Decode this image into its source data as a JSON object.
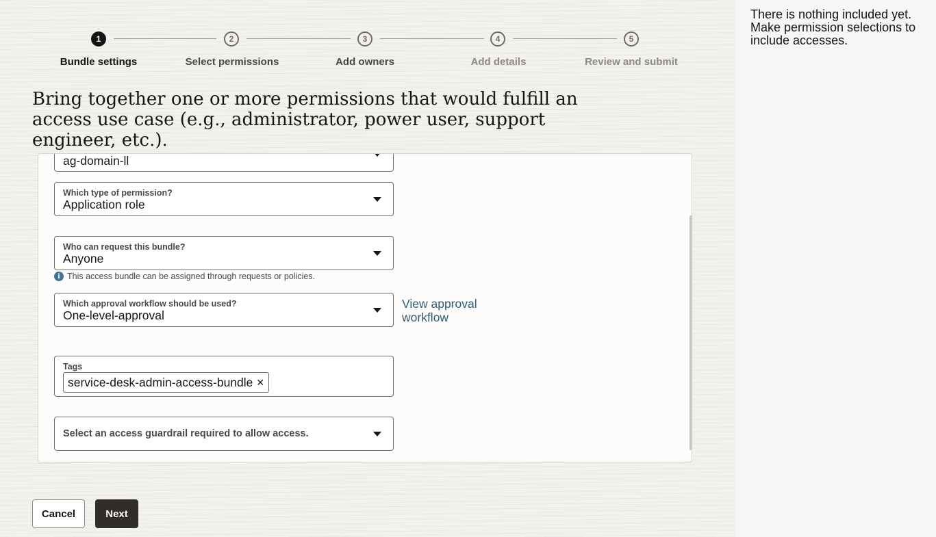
{
  "stepper": {
    "steps": [
      {
        "number": "1",
        "label": "Bundle settings",
        "state": "active"
      },
      {
        "number": "2",
        "label": "Select permissions",
        "state": "next"
      },
      {
        "number": "3",
        "label": "Add owners",
        "state": "next"
      },
      {
        "number": "4",
        "label": "Add details",
        "state": "muted"
      },
      {
        "number": "5",
        "label": "Review and submit",
        "state": "muted"
      }
    ]
  },
  "intro": "Bring together one or more permissions that would fulfill an access use case (e.g., administrator, power user, support engineer, etc.).",
  "form": {
    "domain_select": {
      "value": "ag-domain-ll"
    },
    "permission_type": {
      "label": "Which type of permission?",
      "value": "Application role"
    },
    "requester": {
      "label": "Who can request this bundle?",
      "value": "Anyone",
      "helper": "This access bundle can be assigned through requests or policies."
    },
    "approval_workflow": {
      "label": "Which approval workflow should be used?",
      "value": "One-level-approval"
    },
    "view_approval_link": "View approval workflow",
    "tags": {
      "label": "Tags",
      "chips": [
        "service-desk-admin-access-bundle"
      ]
    },
    "guardrail": {
      "placeholder": "Select an access guardrail required to allow access."
    }
  },
  "actions": {
    "cancel": "Cancel",
    "next": "Next"
  },
  "side_panel": {
    "message": "There is nothing included yet. Make permission selections to include accesses."
  },
  "icons": {
    "info": "info-icon",
    "caret": "chevron-down-icon",
    "remove": "close-icon"
  },
  "colors": {
    "primary_button": "#312d2a",
    "link": "#2c5d7d",
    "info": "#3f7596"
  }
}
